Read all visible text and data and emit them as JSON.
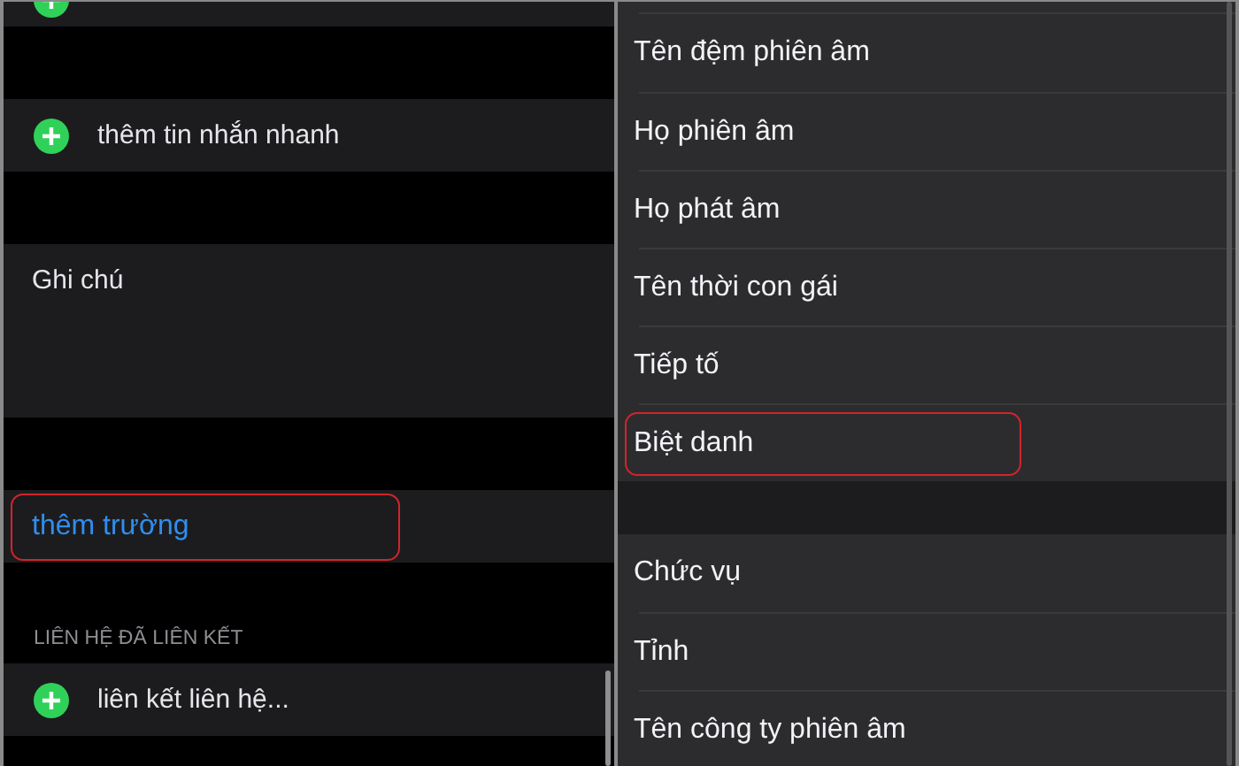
{
  "left_panel": {
    "quick_reply": {
      "label": "thêm tin nhắn nhanh"
    },
    "notes": {
      "label": "Ghi chú"
    },
    "add_field": {
      "label": "thêm trường",
      "highlighted": true
    },
    "linked_contacts": {
      "header": "LIÊN HỆ ĐÃ LIÊN KẾT",
      "label": "liên kết liên hệ..."
    }
  },
  "right_panel": {
    "groups": [
      {
        "items": [
          {
            "label": "Tên đệm phiên âm",
            "highlighted": false
          },
          {
            "label": "Họ phiên âm",
            "highlighted": false
          },
          {
            "label": "Họ phát âm",
            "highlighted": false
          },
          {
            "label": "Tên thời con gái",
            "highlighted": false
          },
          {
            "label": "Tiếp tố",
            "highlighted": false
          },
          {
            "label": "Biệt danh",
            "highlighted": true
          }
        ]
      },
      {
        "items": [
          {
            "label": "Chức vụ",
            "highlighted": false
          },
          {
            "label": "Tỉnh",
            "highlighted": false
          },
          {
            "label": "Tên công ty phiên âm",
            "highlighted": false
          }
        ]
      }
    ]
  }
}
